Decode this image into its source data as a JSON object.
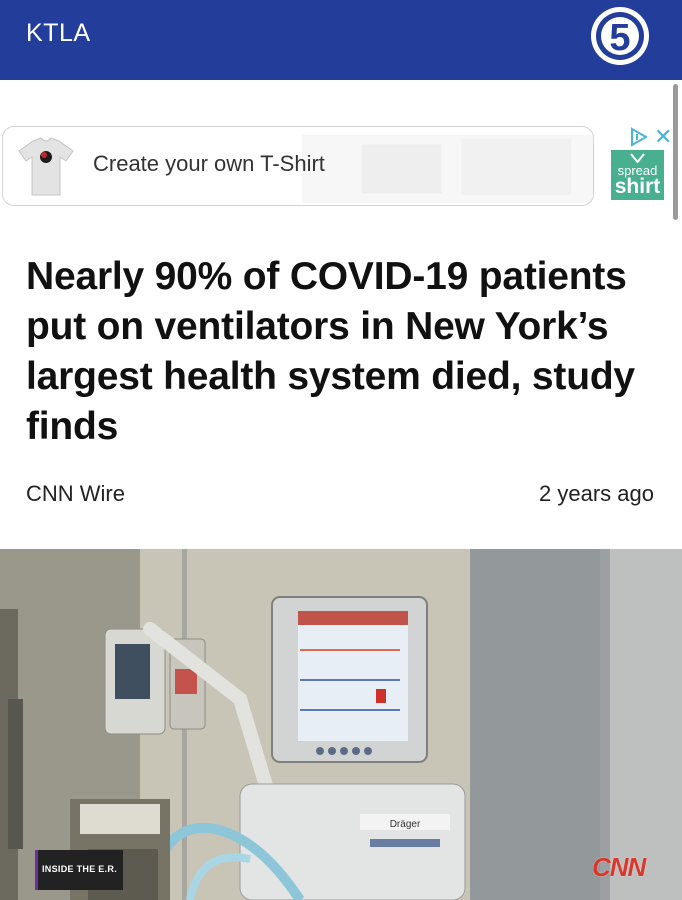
{
  "header": {
    "brand": "KTLA",
    "logo_digit": "5",
    "colors": {
      "bar": "#233d9b",
      "text": "#ffffff"
    }
  },
  "ad": {
    "text": "Create your own T-Shirt",
    "sponsor_top": "spread",
    "sponsor_bottom": "shirt",
    "sponsor_color": "#49b08f",
    "icons": [
      "tshirt-icon",
      "adchoices-icon",
      "close-icon",
      "download-arrow-icon"
    ]
  },
  "article": {
    "headline": "Nearly 90% of COVID-19 patients put on ventilators in New York’s largest health system died, study finds",
    "source": "CNN Wire",
    "age": "2 years ago"
  },
  "photo": {
    "badge": "INSIDE THE E.R.",
    "network": "CNN",
    "monitor_brand": "Dräger"
  }
}
